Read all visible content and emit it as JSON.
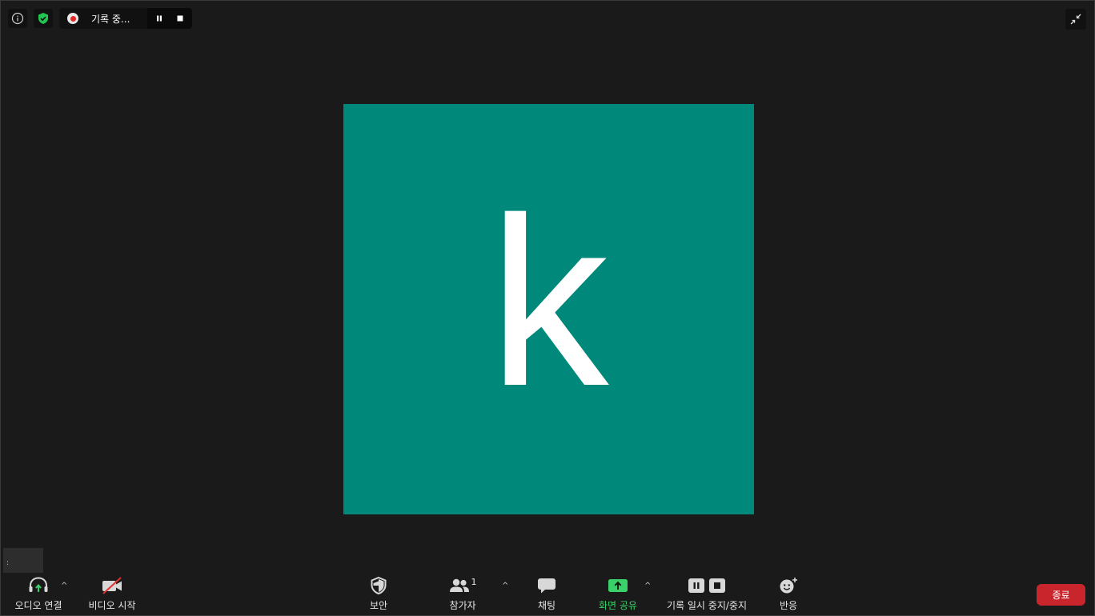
{
  "top_bar": {
    "recording_status": "기록 중..."
  },
  "avatar": {
    "letter": "k",
    "color": "#00897b"
  },
  "toolbar": {
    "audio_label": "오디오 연결",
    "video_label": "비디오 시작",
    "security_label": "보안",
    "participants_label": "참가자",
    "participants_count": "1",
    "chat_label": "채팅",
    "share_label": "화면 공유",
    "recording_label": "기록 일시 중지/중지",
    "reactions_label": "반응",
    "end_label": "종료"
  },
  "colors": {
    "background": "#1a1a1a",
    "share_green": "#3ad16a",
    "end_red": "#c8262c"
  }
}
